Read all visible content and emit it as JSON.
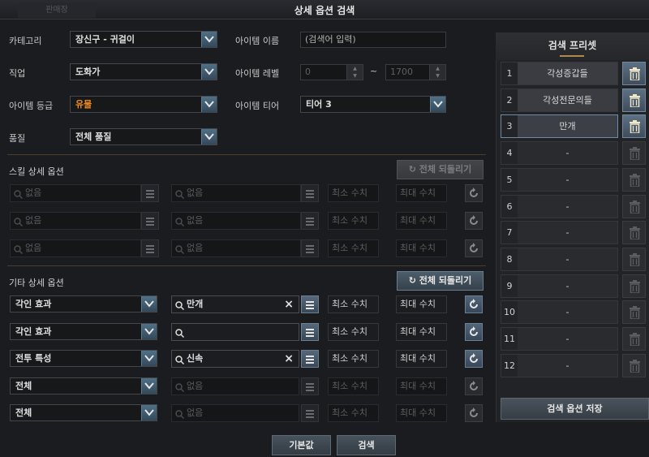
{
  "window": {
    "title": "상세 옵션 검색",
    "ghost_tab": "판매장"
  },
  "filters": {
    "category_label": "카테고리",
    "category_value": "장신구 - 귀걸이",
    "class_label": "직업",
    "class_value": "도화가",
    "grade_label": "아이템 등급",
    "grade_value": "유물",
    "quality_label": "품질",
    "quality_value": "전체 품질",
    "name_label": "아이템 이름",
    "name_placeholder": "(검색어 입력)",
    "level_label": "아이템 레벨",
    "level_min": "0",
    "level_tilde": "~",
    "level_max": "1700",
    "tier_label": "아이템 티어",
    "tier_value": "티어 3"
  },
  "skill_section": {
    "title": "스킬 상세 옵션",
    "reset_label": "전체 되돌리기",
    "rows": [
      {
        "left": "없음",
        "right": "없음",
        "min": "최소 수치",
        "max": "최대 수치"
      },
      {
        "left": "없음",
        "right": "없음",
        "min": "최소 수치",
        "max": "최대 수치"
      },
      {
        "left": "없음",
        "right": "없음",
        "min": "최소 수치",
        "max": "최대 수치"
      }
    ]
  },
  "etc_section": {
    "title": "기타 상세 옵션",
    "reset_label": "전체 되돌리기",
    "rows": [
      {
        "type": "각인 효과",
        "search": "만개",
        "min": "최소 수치",
        "max": "최대 수치"
      },
      {
        "type": "각인 효과",
        "search": "",
        "min": "최소 수치",
        "max": "최대 수치"
      },
      {
        "type": "전투 특성",
        "search": "신속",
        "min": "최소 수치",
        "max": "최대 수치"
      },
      {
        "type": "전체",
        "search": "없음",
        "min": "최소 수치",
        "max": "최대 수치"
      },
      {
        "type": "전체",
        "search": "없음",
        "min": "최소 수치",
        "max": "최대 수치"
      }
    ],
    "clear_icon": "×"
  },
  "presets": {
    "title": "검색 프리셋",
    "items": [
      {
        "num": "1",
        "name": "각성증갑들"
      },
      {
        "num": "2",
        "name": "각성전문의들"
      },
      {
        "num": "3",
        "name": "만개"
      },
      {
        "num": "4",
        "name": "-"
      },
      {
        "num": "5",
        "name": "-"
      },
      {
        "num": "6",
        "name": "-"
      },
      {
        "num": "7",
        "name": "-"
      },
      {
        "num": "8",
        "name": "-"
      },
      {
        "num": "9",
        "name": "-"
      },
      {
        "num": "10",
        "name": "-"
      },
      {
        "num": "11",
        "name": "-"
      },
      {
        "num": "12",
        "name": "-"
      }
    ],
    "save_label": "검색 옵션 저장"
  },
  "footer": {
    "default_label": "기본값",
    "search_label": "검색"
  },
  "colors": {
    "accent": "#4f7086",
    "grade_orange": "#f08a24",
    "selected_border": "#6d8aa8"
  }
}
